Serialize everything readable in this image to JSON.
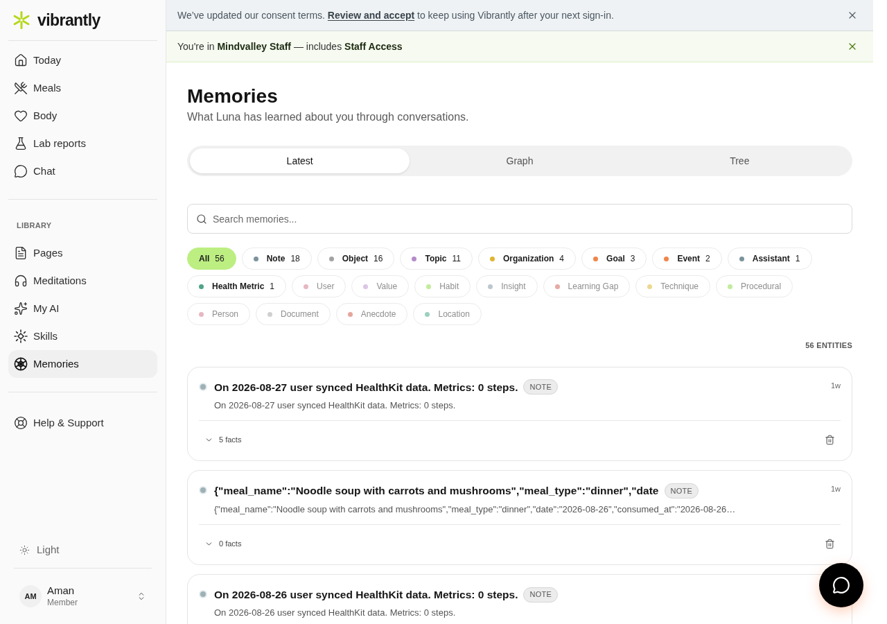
{
  "sidebar": {
    "brand": "vibrantly",
    "nav": [
      {
        "label": "Today",
        "selected": false
      },
      {
        "label": "Meals",
        "selected": false
      },
      {
        "label": "Body",
        "selected": false
      },
      {
        "label": "Lab reports",
        "selected": false
      },
      {
        "label": "Chat",
        "selected": false
      }
    ],
    "library_heading": "LIBRARY",
    "library": [
      {
        "label": "Pages",
        "selected": false
      },
      {
        "label": "Meditations",
        "selected": false
      },
      {
        "label": "My AI",
        "selected": false
      },
      {
        "label": "Skills",
        "selected": false
      },
      {
        "label": "Memories",
        "selected": true
      }
    ],
    "support": [
      {
        "label": "Help & Support",
        "selected": false
      }
    ],
    "theme_toggle": {
      "label": "Light"
    },
    "user": {
      "initials": "AM",
      "name": "Aman",
      "role": "Member"
    }
  },
  "banners": [
    {
      "kind": "notice",
      "text_before": "We’ve updated our consent terms.",
      "link": "Review and accept",
      "text_after": "to keep using Vibrantly after your next sign-in."
    },
    {
      "kind": "success",
      "text": "You're in **Mindvalley Staff** — includes **Staff Access**"
    }
  ],
  "page": {
    "title": "Memories",
    "subtitle": "What Luna has learned about you through conversations."
  },
  "tabs": [
    {
      "label": "Latest",
      "selected": true
    },
    {
      "label": "Graph",
      "selected": false
    },
    {
      "label": "Tree",
      "selected": false
    }
  ],
  "search": {
    "placeholder": "Search memories..."
  },
  "filters": [
    {
      "label": "All",
      "count": "56",
      "selected": true,
      "disabled": false
    },
    {
      "label": "Note",
      "count": "18",
      "color": "#7b939c",
      "selected": false,
      "disabled": false
    },
    {
      "label": "Object",
      "count": "16",
      "color": "#a3a3a3",
      "selected": false,
      "disabled": false
    },
    {
      "label": "Topic",
      "count": "11",
      "color": "#b48bc9",
      "selected": false,
      "disabled": false
    },
    {
      "label": "Organization",
      "count": "4",
      "color": "#e0b52f",
      "selected": false,
      "disabled": false
    },
    {
      "label": "Goal",
      "count": "3",
      "color": "#f0854a",
      "selected": false,
      "disabled": false
    },
    {
      "label": "Event",
      "count": "2",
      "color": "#f0854a",
      "selected": false,
      "disabled": false
    },
    {
      "label": "Assistant",
      "count": "1",
      "color": "#7b939c",
      "selected": false,
      "disabled": false
    },
    {
      "label": "Health Metric",
      "count": "1",
      "color": "#4fa386",
      "selected": false,
      "disabled": false
    },
    {
      "label": "User",
      "color": "#e6b8c2",
      "selected": false,
      "disabled": true
    },
    {
      "label": "Value",
      "color": "#dcc6e6",
      "selected": false,
      "disabled": true
    },
    {
      "label": "Habit",
      "color": "#c2ec9c",
      "selected": false,
      "disabled": true
    },
    {
      "label": "Insight",
      "color": "#bbc8ce",
      "selected": false,
      "disabled": true
    },
    {
      "label": "Learning Gap",
      "color": "#e5aba3",
      "selected": false,
      "disabled": true
    },
    {
      "label": "Technique",
      "color": "#ecd891",
      "selected": false,
      "disabled": true
    },
    {
      "label": "Procedural",
      "color": "#c2ec9c",
      "selected": false,
      "disabled": true
    },
    {
      "label": "Person",
      "color": "#e6b8c2",
      "selected": false,
      "disabled": true
    },
    {
      "label": "Document",
      "color": "#d0d0d0",
      "selected": false,
      "disabled": true
    },
    {
      "label": "Anecdote",
      "color": "#e5a69d",
      "selected": false,
      "disabled": true
    },
    {
      "label": "Location",
      "color": "#9dd0be",
      "selected": false,
      "disabled": true
    }
  ],
  "entity_count": "56 ENTITIES",
  "memories": [
    {
      "title": "On 2026-08-27 user synced HealthKit data. Metrics: 0 steps.",
      "badge": "NOTE",
      "time": "1w",
      "summary": "On 2026-08-27 user synced HealthKit data. Metrics: 0 steps.",
      "facts": "5 facts",
      "expanded": false
    },
    {
      "title": "{\"meal_name\":\"Noodle soup with carrots and mushrooms\",\"meal_type\":\"dinner\",\"date",
      "badge": "NOTE",
      "time": "1w",
      "summary": "{\"meal_name\":\"Noodle soup with carrots and mushrooms\",\"meal_type\":\"dinner\",\"date\":\"2026-08-26\",\"consumed_at\":\"2026-08-26…",
      "facts": "0 facts",
      "expanded": false
    },
    {
      "title": "On 2026-08-26 user synced HealthKit data. Metrics: 0 steps.",
      "badge": "NOTE",
      "summary": "On 2026-08-26 user synced HealthKit data. Metrics: 0 steps."
    }
  ]
}
